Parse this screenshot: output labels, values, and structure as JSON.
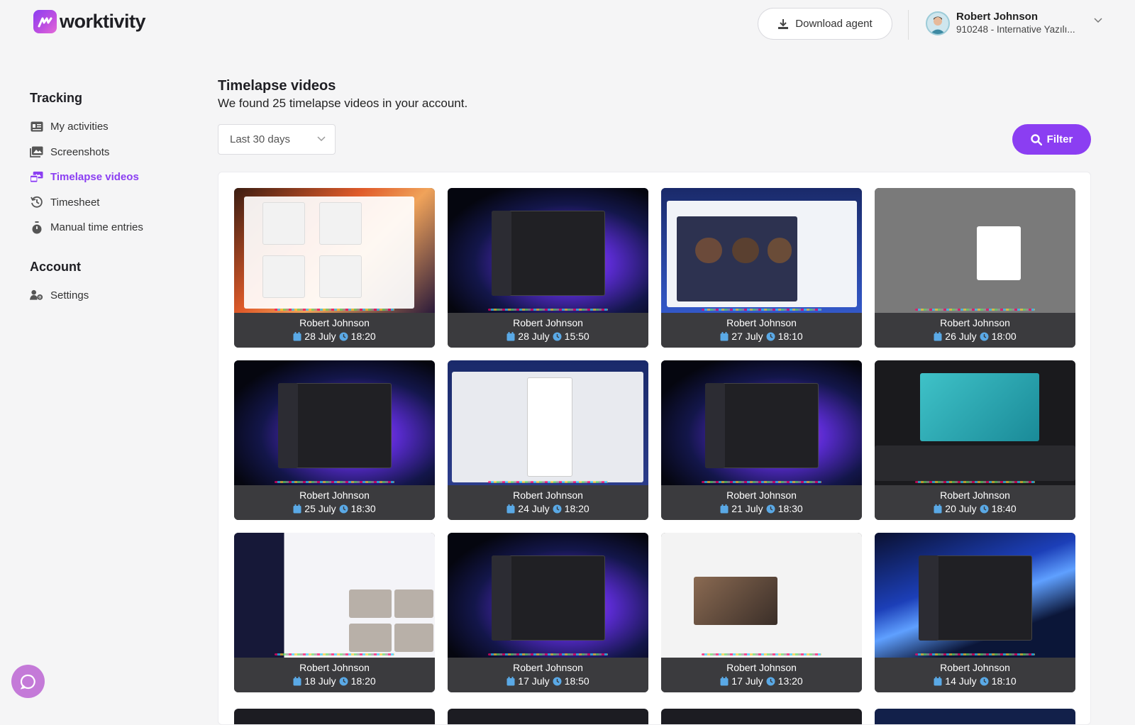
{
  "brand": {
    "name": "worktivity"
  },
  "header": {
    "download_label": "Download agent",
    "user_name": "Robert Johnson",
    "user_sub": "910248 - Internative Yazılı..."
  },
  "sidebar": {
    "tracking_title": "Tracking",
    "items": [
      {
        "label": "My activities",
        "icon": "id-card-icon"
      },
      {
        "label": "Screenshots",
        "icon": "images-icon"
      },
      {
        "label": "Timelapse videos",
        "icon": "photo-video-icon",
        "active": true
      },
      {
        "label": "Timesheet",
        "icon": "history-icon"
      },
      {
        "label": "Manual time entries",
        "icon": "stopwatch-icon"
      }
    ],
    "account_title": "Account",
    "account_items": [
      {
        "label": "Settings",
        "icon": "user-cog-icon"
      }
    ]
  },
  "main": {
    "title": "Timelapse videos",
    "subtitle": "We found 25 timelapse videos in your account.",
    "range_value": "Last 30 days",
    "filter_label": "Filter"
  },
  "videos": [
    {
      "name": "Robert Johnson",
      "date": "28 July",
      "time": "18:20",
      "theme": "orange"
    },
    {
      "name": "Robert Johnson",
      "date": "28 July",
      "time": "15:50",
      "theme": "swirl"
    },
    {
      "name": "Robert Johnson",
      "date": "27 July",
      "time": "18:10",
      "theme": "meet"
    },
    {
      "name": "Robert Johnson",
      "date": "26 July",
      "time": "18:00",
      "theme": "gray"
    },
    {
      "name": "Robert Johnson",
      "date": "25 July",
      "time": "18:30",
      "theme": "swirl"
    },
    {
      "name": "Robert Johnson",
      "date": "24 July",
      "time": "18:20",
      "theme": "light"
    },
    {
      "name": "Robert Johnson",
      "date": "21 July",
      "time": "18:30",
      "theme": "swirl"
    },
    {
      "name": "Robert Johnson",
      "date": "20 July",
      "time": "18:40",
      "theme": "teal"
    },
    {
      "name": "Robert Johnson",
      "date": "18 July",
      "time": "18:20",
      "theme": "blog"
    },
    {
      "name": "Robert Johnson",
      "date": "17 July",
      "time": "18:50",
      "theme": "swirl"
    },
    {
      "name": "Robert Johnson",
      "date": "17 July",
      "time": "13:20",
      "theme": "white"
    },
    {
      "name": "Robert Johnson",
      "date": "14 July",
      "time": "18:10",
      "theme": "swirl2"
    }
  ],
  "colors": {
    "accent": "#8b3ef2",
    "card": "#3b3b3e",
    "clock": "#5aa9e6"
  }
}
